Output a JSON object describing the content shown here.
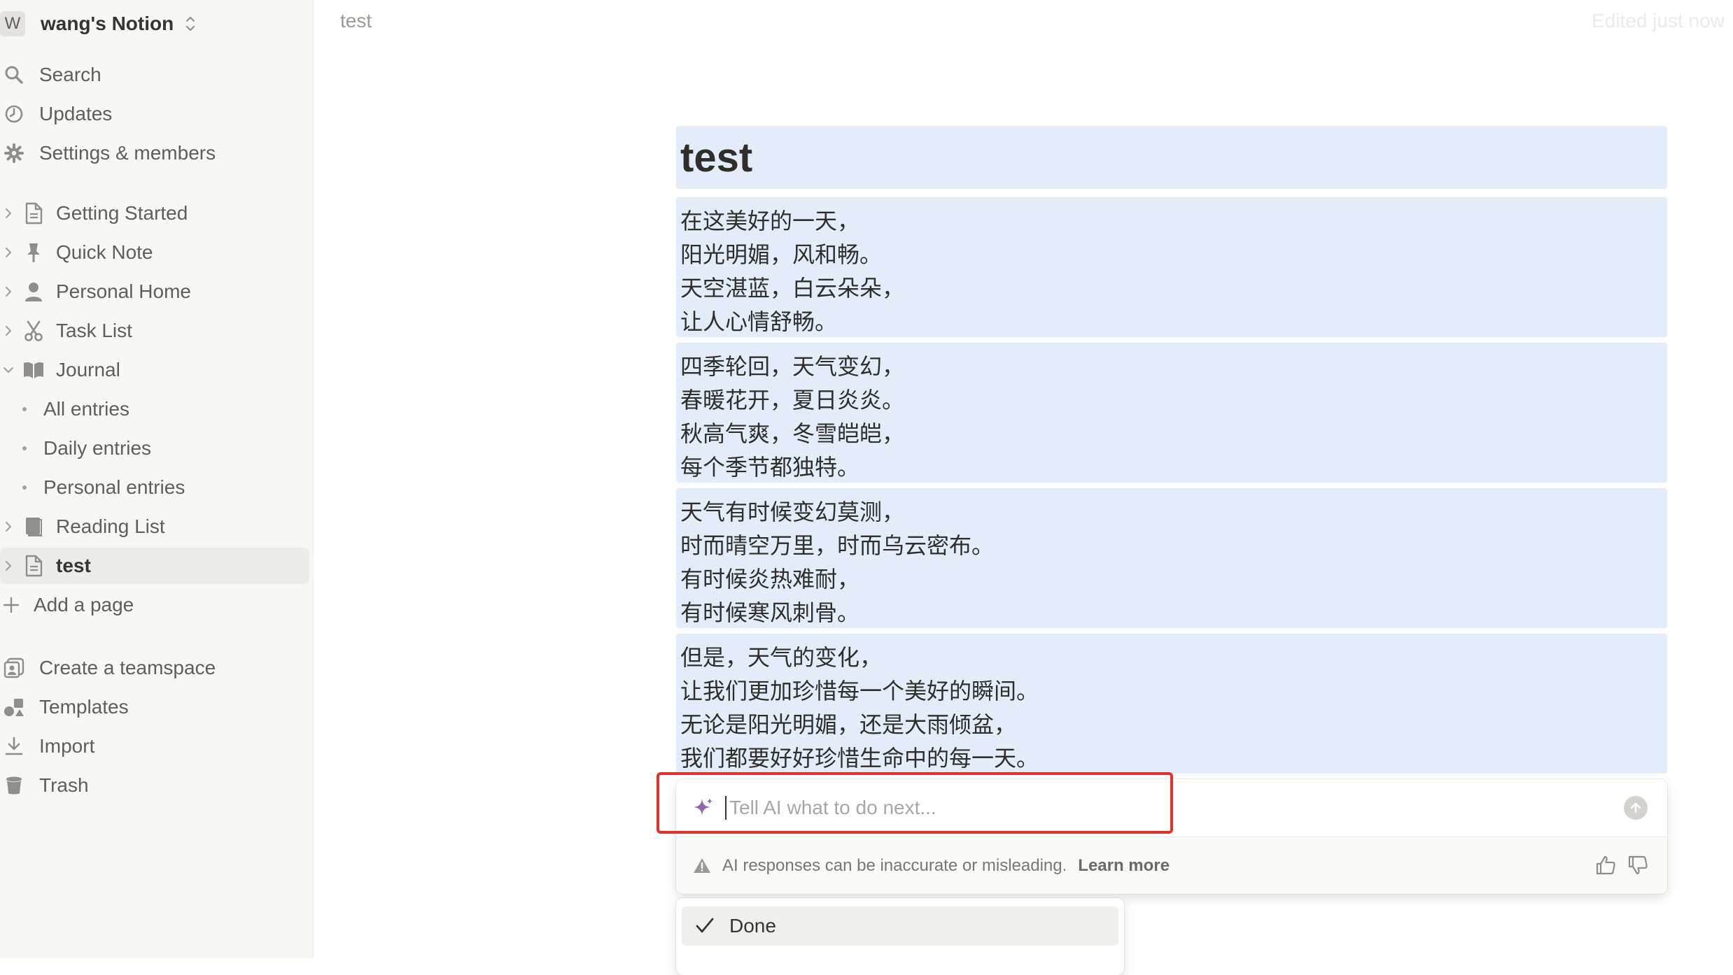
{
  "workspace": {
    "avatar": "W",
    "name": "wang's Notion"
  },
  "sidebar": {
    "top": [
      {
        "label": "Search",
        "icon": "search-icon"
      },
      {
        "label": "Updates",
        "icon": "clock-icon"
      },
      {
        "label": "Settings & members",
        "icon": "gear-icon"
      }
    ],
    "pages": [
      {
        "label": "Getting Started",
        "icon": "page-icon"
      },
      {
        "label": "Quick Note",
        "icon": "pin-icon"
      },
      {
        "label": "Personal Home",
        "icon": "person-icon"
      },
      {
        "label": "Task List",
        "icon": "scissors-icon"
      },
      {
        "label": "Journal",
        "icon": "book-icon",
        "expanded": true
      }
    ],
    "journal_children": [
      {
        "label": "All entries"
      },
      {
        "label": "Daily entries"
      },
      {
        "label": "Personal entries"
      }
    ],
    "pages_after": [
      {
        "label": "Reading List",
        "icon": "books-icon"
      },
      {
        "label": "test",
        "icon": "page-icon",
        "active": true
      }
    ],
    "add_page": "Add a page",
    "bottom": [
      {
        "label": "Create a teamspace",
        "icon": "teamspace-icon"
      },
      {
        "label": "Templates",
        "icon": "templates-icon"
      },
      {
        "label": "Import",
        "icon": "import-icon"
      },
      {
        "label": "Trash",
        "icon": "trash-icon"
      }
    ]
  },
  "topbar": {
    "breadcrumb": "test",
    "edited": "Edited just now"
  },
  "page": {
    "title": "test",
    "heading": "test",
    "stanzas": [
      [
        "在这美好的一天，",
        "阳光明媚，风和畅。",
        "天空湛蓝，白云朵朵，",
        "让人心情舒畅。"
      ],
      [
        "四季轮回，天气变幻，",
        "春暖花开，夏日炎炎。",
        "秋高气爽，冬雪皑皑，",
        "每个季节都独特。"
      ],
      [
        "天气有时候变幻莫测，",
        "时而晴空万里，时而乌云密布。",
        "有时候炎热难耐，",
        "有时候寒风刺骨。"
      ],
      [
        "但是，天气的变化，",
        "让我们更加珍惜每一个美好的瞬间。",
        "无论是阳光明媚，还是大雨倾盆，",
        "我们都要好好珍惜生命中的每一天。"
      ]
    ]
  },
  "ai": {
    "placeholder": "Tell AI what to do next...",
    "disclaimer": "AI responses can be inaccurate or misleading.",
    "learn_more": "Learn more",
    "accent": "#9065b0"
  },
  "menu": {
    "items": [
      {
        "label": "Done",
        "icon": "checkmark-icon"
      }
    ]
  }
}
